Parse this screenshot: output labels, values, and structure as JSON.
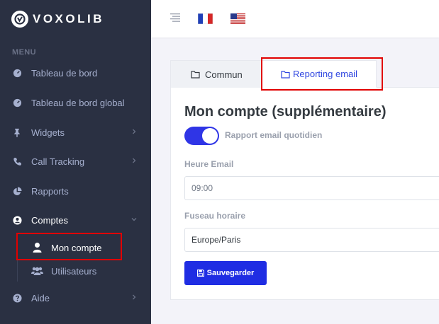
{
  "app": {
    "logo_text": "VOXOLIB"
  },
  "sidebar": {
    "menu_title": "MENU",
    "items": [
      {
        "label": "Tableau de bord",
        "icon": "dashboard-icon"
      },
      {
        "label": "Tableau de bord global",
        "icon": "dashboard-icon"
      },
      {
        "label": "Widgets",
        "icon": "pin-icon",
        "has_chevron": true
      },
      {
        "label": "Call Tracking",
        "icon": "phone-icon",
        "has_chevron": true
      },
      {
        "label": "Rapports",
        "icon": "pie-chart-icon"
      },
      {
        "label": "Comptes",
        "icon": "user-circle-icon",
        "has_chevron": true,
        "expanded": true
      },
      {
        "label": "Aide",
        "icon": "question-circle-icon",
        "has_chevron": true
      }
    ],
    "sub_items": [
      {
        "label": "Mon compte",
        "icon": "user-icon",
        "active": true
      },
      {
        "label": "Utilisateurs",
        "icon": "users-icon"
      }
    ]
  },
  "topbar": {
    "languages": [
      {
        "code": "fr",
        "icon": "flag-fr-icon"
      },
      {
        "code": "en",
        "icon": "flag-us-icon"
      }
    ]
  },
  "tabs": [
    {
      "label": "Commun",
      "icon": "folder-icon",
      "active": false
    },
    {
      "label": "Reporting email",
      "icon": "folder-icon",
      "active": true
    }
  ],
  "form": {
    "title": "Mon compte (supplémentaire)",
    "toggle": {
      "label": "Rapport email quotidien",
      "checked": true
    },
    "time_label": "Heure Email",
    "time_value": "09:00",
    "timezone_label": "Fuseau horaire",
    "timezone_value": "Europe/Paris",
    "save_label": "Sauvegarder"
  },
  "colors": {
    "sidebar_bg": "#2a3042",
    "accent": "#2f35e6",
    "highlight": "#e10000"
  }
}
